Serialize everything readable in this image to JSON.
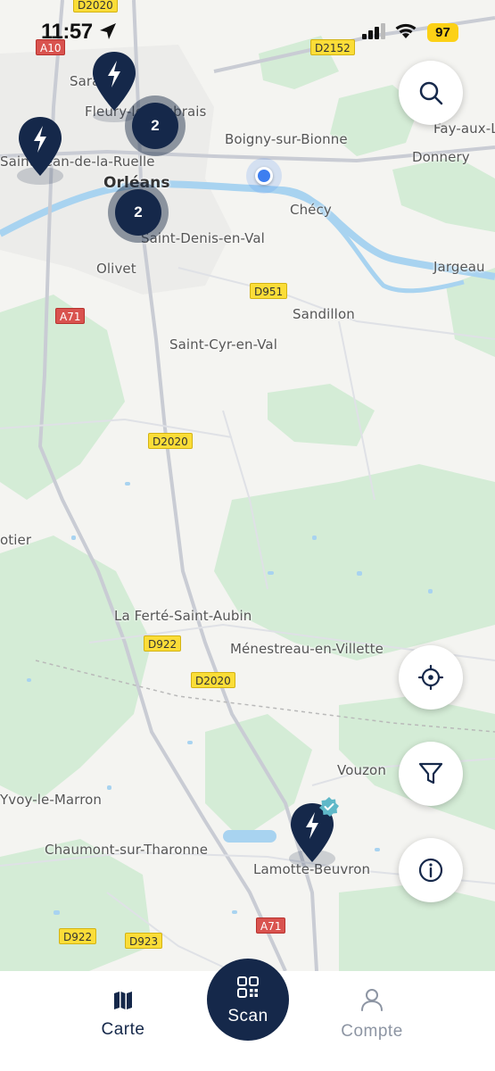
{
  "status_bar": {
    "time": "11:57",
    "battery": "97"
  },
  "map": {
    "places": [
      {
        "key": "fleury",
        "text": "Fleury-les-Aubrais"
      },
      {
        "key": "saran",
        "text": "Saran"
      },
      {
        "key": "saint_jean",
        "text": "Saint-Jean-de-la-Ruelle"
      },
      {
        "key": "orleans",
        "text": "Orléans"
      },
      {
        "key": "boigny",
        "text": "Boigny-sur-Bionne"
      },
      {
        "key": "fay",
        "text": "Fay-aux-L"
      },
      {
        "key": "donnery",
        "text": "Donnery"
      },
      {
        "key": "checy",
        "text": "Chécy"
      },
      {
        "key": "saint_denis",
        "text": "Saint-Denis-en-Val"
      },
      {
        "key": "olivet",
        "text": "Olivet"
      },
      {
        "key": "jargeau",
        "text": "Jargeau"
      },
      {
        "key": "sandillon",
        "text": "Sandillon"
      },
      {
        "key": "saint_cyr",
        "text": "Saint-Cyr-en-Val"
      },
      {
        "key": "otier",
        "text": "otier"
      },
      {
        "key": "ferte",
        "text": "La Ferté-Saint-Aubin"
      },
      {
        "key": "menestreau",
        "text": "Ménestreau-en-Villette"
      },
      {
        "key": "vouzon",
        "text": "Vouzon"
      },
      {
        "key": "yvoy",
        "text": "Yvoy-le-Marron"
      },
      {
        "key": "chaumont",
        "text": "Chaumont-sur-Tharonne"
      },
      {
        "key": "lamotte",
        "text": "Lamotte-Beuvron"
      }
    ],
    "roads": {
      "d2020_top": "D2020",
      "a10": "A10",
      "d2152": "D2152",
      "a71_north": "A71",
      "d951": "D951",
      "d2020_mid": "D2020",
      "d922_mid": "D922",
      "d2020_south": "D2020",
      "a71_south": "A71",
      "d922_south": "D922",
      "d923": "D923"
    },
    "clusters": [
      {
        "count": "2"
      },
      {
        "count": "2"
      }
    ]
  },
  "controls": {
    "search": "search-icon",
    "locate": "crosshair-icon",
    "filter": "funnel-icon",
    "info": "info-icon"
  },
  "tabbar": {
    "map_label": "Carte",
    "scan_label": "Scan",
    "account_label": "Compte"
  },
  "colors": {
    "brand_navy": "#15284a",
    "map_green": "#d4ecd6",
    "water_blue": "#a8d3f0",
    "battery_yellow": "#fcd116",
    "location_blue": "#3d7ef0",
    "verified_teal": "#5fb8c8"
  }
}
